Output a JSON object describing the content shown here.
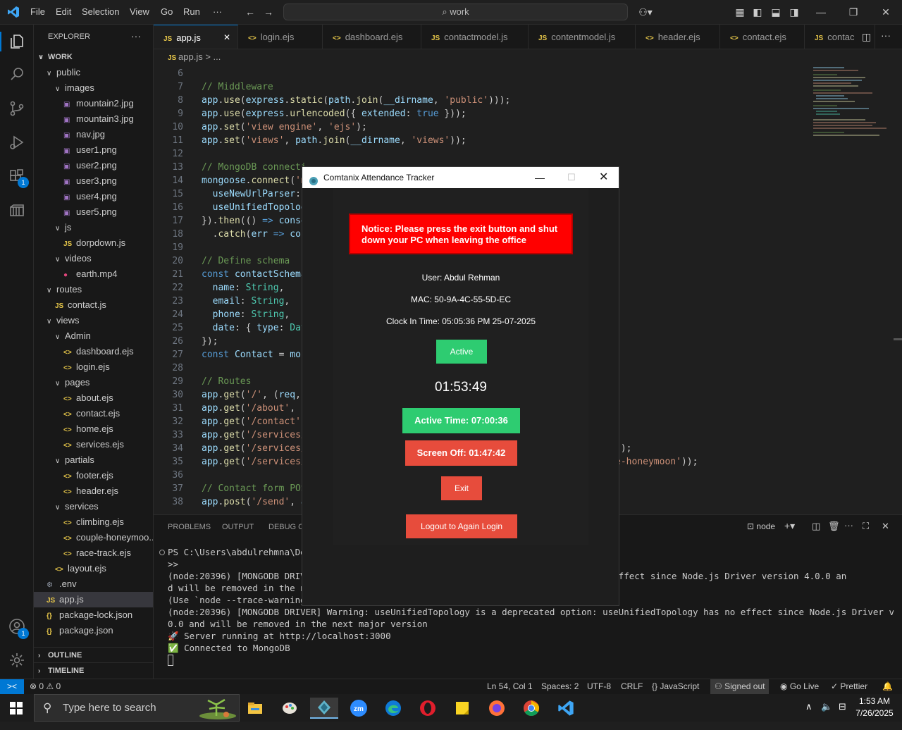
{
  "titlebar": {
    "menu": [
      "File",
      "Edit",
      "Selection",
      "View",
      "Go",
      "Run",
      "···"
    ],
    "search_text": "work"
  },
  "activity": {
    "extensions_badge": "1",
    "accounts_badge": "1"
  },
  "sidebar": {
    "header": "EXPLORER",
    "more": "···",
    "root": "WORK",
    "rows": [
      {
        "label": "public",
        "kind": "folder",
        "depth": 1
      },
      {
        "label": "images",
        "kind": "folder",
        "depth": 2
      },
      {
        "label": "mountain2.jpg",
        "kind": "img",
        "depth": 3
      },
      {
        "label": "mountain3.jpg",
        "kind": "img",
        "depth": 3
      },
      {
        "label": "nav.jpg",
        "kind": "img",
        "depth": 3
      },
      {
        "label": "user1.png",
        "kind": "img",
        "depth": 3
      },
      {
        "label": "user2.png",
        "kind": "img",
        "depth": 3
      },
      {
        "label": "user3.png",
        "kind": "img",
        "depth": 3
      },
      {
        "label": "user4.png",
        "kind": "img",
        "depth": 3
      },
      {
        "label": "user5.png",
        "kind": "img",
        "depth": 3
      },
      {
        "label": "js",
        "kind": "folder",
        "depth": 2
      },
      {
        "label": "dorpdown.js",
        "kind": "js",
        "depth": 3
      },
      {
        "label": "videos",
        "kind": "folder",
        "depth": 2
      },
      {
        "label": "earth.mp4",
        "kind": "vid",
        "depth": 3
      },
      {
        "label": "routes",
        "kind": "folder",
        "depth": 1
      },
      {
        "label": "contact.js",
        "kind": "js",
        "depth": 2
      },
      {
        "label": "views",
        "kind": "folder",
        "depth": 1
      },
      {
        "label": "Admin",
        "kind": "folder",
        "depth": 2
      },
      {
        "label": "dashboard.ejs",
        "kind": "ejs",
        "depth": 3
      },
      {
        "label": "login.ejs",
        "kind": "ejs",
        "depth": 3
      },
      {
        "label": "pages",
        "kind": "folder",
        "depth": 2
      },
      {
        "label": "about.ejs",
        "kind": "ejs",
        "depth": 3
      },
      {
        "label": "contact.ejs",
        "kind": "ejs",
        "depth": 3
      },
      {
        "label": "home.ejs",
        "kind": "ejs",
        "depth": 3
      },
      {
        "label": "services.ejs",
        "kind": "ejs",
        "depth": 3
      },
      {
        "label": "partials",
        "kind": "folder",
        "depth": 2
      },
      {
        "label": "footer.ejs",
        "kind": "ejs",
        "depth": 3
      },
      {
        "label": "header.ejs",
        "kind": "ejs",
        "depth": 3
      },
      {
        "label": "services",
        "kind": "folder",
        "depth": 2
      },
      {
        "label": "climbing.ejs",
        "kind": "ejs",
        "depth": 3
      },
      {
        "label": "couple-honeymoo...",
        "kind": "ejs",
        "depth": 3
      },
      {
        "label": "race-track.ejs",
        "kind": "ejs",
        "depth": 3
      },
      {
        "label": "layout.ejs",
        "kind": "ejs",
        "depth": 2
      },
      {
        "label": ".env",
        "kind": "env",
        "depth": 1
      },
      {
        "label": "app.js",
        "kind": "js",
        "depth": 1,
        "selected": true
      },
      {
        "label": "package-lock.json",
        "kind": "json",
        "depth": 1
      },
      {
        "label": "package.json",
        "kind": "json",
        "depth": 1
      }
    ],
    "outline": "OUTLINE",
    "timeline": "TIMELINE"
  },
  "tabs": [
    {
      "label": "app.js",
      "icon": "JS",
      "active": true
    },
    {
      "label": "login.ejs",
      "icon": "<>"
    },
    {
      "label": "dashboard.ejs",
      "icon": "<>"
    },
    {
      "label": "contactmodel.js",
      "icon": "JS"
    },
    {
      "label": "contentmodel.js",
      "icon": "JS"
    },
    {
      "label": "header.ejs",
      "icon": "<>"
    },
    {
      "label": "contact.ejs",
      "icon": "<>"
    },
    {
      "label": "contac",
      "icon": "JS"
    }
  ],
  "breadcrumb": {
    "file": "app.js",
    "rest": "> ..."
  },
  "code": [
    {
      "n": "6",
      "html": ""
    },
    {
      "n": "7",
      "html": "<span class='c'>// Middleware</span>"
    },
    {
      "n": "8",
      "html": "<span class='v'>app</span>.<span class='f'>use</span>(<span class='v'>express</span>.<span class='f'>static</span>(<span class='v'>path</span>.<span class='f'>join</span>(<span class='v'>__dirname</span>, <span class='s'>'public'</span>)));"
    },
    {
      "n": "9",
      "html": "<span class='v'>app</span>.<span class='f'>use</span>(<span class='v'>express</span>.<span class='f'>urlencoded</span>({ <span class='v'>extended</span>: <span class='b'>true</span> }));"
    },
    {
      "n": "10",
      "html": "<span class='v'>app</span>.<span class='f'>set</span>(<span class='s'>'view engine'</span>, <span class='s'>'ejs'</span>);"
    },
    {
      "n": "11",
      "html": "<span class='v'>app</span>.<span class='f'>set</span>(<span class='s'>'views'</span>, <span class='v'>path</span>.<span class='f'>join</span>(<span class='v'>__dirname</span>, <span class='s'>'views'</span>));"
    },
    {
      "n": "12",
      "html": ""
    },
    {
      "n": "13",
      "html": "<span class='c'>// MongoDB connecti</span>"
    },
    {
      "n": "14",
      "html": "<span class='v'>mongoose</span>.<span class='f'>connect</span>(<span class='s'>'m</span>"
    },
    {
      "n": "15",
      "html": "  <span class='v'>useNewUrlParser</span>:"
    },
    {
      "n": "16",
      "html": "  <span class='v'>useUnifiedTopolog</span>"
    },
    {
      "n": "17",
      "html": "}).<span class='f'>then</span>(() <span class='k'>=&gt;</span> <span class='v'>conso</span>"
    },
    {
      "n": "18",
      "html": "  .<span class='f'>catch</span>(<span class='v'>err</span> <span class='k'>=&gt;</span> <span class='v'>cor</span>"
    },
    {
      "n": "19",
      "html": ""
    },
    {
      "n": "20",
      "html": "<span class='c'>// Define schema</span>"
    },
    {
      "n": "21",
      "html": "<span class='k'>const</span> <span class='v'>contactSchema</span>"
    },
    {
      "n": "22",
      "html": "  <span class='v'>name</span>: <span class='t'>String</span>,"
    },
    {
      "n": "23",
      "html": "  <span class='v'>email</span>: <span class='t'>String</span>,"
    },
    {
      "n": "24",
      "html": "  <span class='v'>phone</span>: <span class='t'>String</span>,"
    },
    {
      "n": "25",
      "html": "  <span class='v'>date</span>: { <span class='v'>type</span>: <span class='t'>Dat</span>"
    },
    {
      "n": "26",
      "html": "});"
    },
    {
      "n": "27",
      "html": "<span class='k'>const</span> <span class='v'>Contact</span> = <span class='v'>mon</span>"
    },
    {
      "n": "28",
      "html": ""
    },
    {
      "n": "29",
      "html": "<span class='c'>// Routes</span>"
    },
    {
      "n": "30",
      "html": "<span class='v'>app</span>.<span class='f'>get</span>(<span class='s'>'/'</span>, (<span class='v'>req</span>,"
    },
    {
      "n": "31",
      "html": "<span class='v'>app</span>.<span class='f'>get</span>(<span class='s'>'/about'</span>, ("
    },
    {
      "n": "32",
      "html": "<span class='v'>app</span>.<span class='f'>get</span>(<span class='s'>'/contact'</span>,"
    },
    {
      "n": "33",
      "html": "<span class='v'>app</span>.<span class='f'>get</span>(<span class='s'>'/services/</span>"
    },
    {
      "n": "34",
      "html": "<span class='v'>app</span>.<span class='f'>get</span>(<span class='s'>'/services/</span>                                                       <span class='s'>'</span>));"
    },
    {
      "n": "35",
      "html": "<span class='v'>app</span>.<span class='f'>get</span>(<span class='s'>'/services/</span>                                                       <span class='s'>le-honeymoon'</span>));"
    },
    {
      "n": "36",
      "html": ""
    },
    {
      "n": "37",
      "html": "<span class='c'>// Contact form POS</span>"
    },
    {
      "n": "38",
      "html": "<span class='v'>app</span>.<span class='f'>post</span>(<span class='s'>'/send'</span>, <span class='v'>a</span>"
    }
  ],
  "panel": {
    "tabs": [
      "PROBLEMS",
      "OUTPUT",
      "DEBUG CO"
    ],
    "shell": "node",
    "lines": [
      "PS C:\\Users\\abdulrehmna\\Des",
      ">>",
      "(node:20396) [MONGODB DRIVEI                                             ser has no effect since Node.js Driver version 4.0.0 an",
      "d will be removed in the ne",
      "(Use `node --trace-warnings",
      "(node:20396) [MONGODB DRIVER] Warning: useUnifiedTopology is a deprecated option: useUnifiedTopology has no effect since Node.js Driver version 4.",
      "0.0 and will be removed in the next major version",
      "🚀 Server running at http://localhost:3000",
      "✅ Connected to MongoDB",
      ""
    ]
  },
  "status": {
    "remote": "><",
    "errors": "0",
    "warnings": "0",
    "position": "Ln 54, Col 1",
    "spaces": "Spaces: 2",
    "encoding": "UTF-8",
    "eol": "CRLF",
    "language": "JavaScript",
    "signed": "Signed out",
    "golive": "Go Live",
    "prettier": "Prettier"
  },
  "taskbar": {
    "search_placeholder": "Type here to search",
    "time": "1:53 AM",
    "date": "7/26/2025"
  },
  "tracker": {
    "title": "Comtanix Attendance Tracker",
    "notice": "Notice: Please press the exit button and shut down your PC when leaving the office",
    "user": "User: Abdul Rehman",
    "mac": "MAC: 50-9A-4C-55-5D-EC",
    "clock_in": "Clock In Time: 05:05:36 PM 25-07-2025",
    "status_button": "Active",
    "timer": "01:53:49",
    "active_time": "Active Time: 07:00:36",
    "screen_off": "Screen Off: 01:47:42",
    "exit": "Exit",
    "logout": "Logout to Again Login",
    "colors": {
      "green": "#2ecc71",
      "red": "#e74c3c",
      "notice": "#ff0000"
    }
  }
}
